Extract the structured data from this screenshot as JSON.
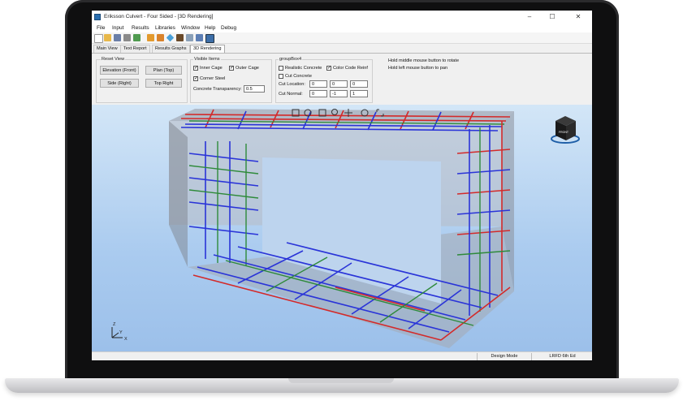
{
  "window": {
    "title": "Eriksson Culvert - Four Sided - [3D Rendering]",
    "minimize": "–",
    "maximize": "☐",
    "close": "✕"
  },
  "menu": [
    "File",
    "Input",
    "Results",
    "Libraries",
    "Window",
    "Help",
    "Debug"
  ],
  "tabs": [
    "Main View",
    "Text Report",
    "Results Graphs",
    "3D Rendering"
  ],
  "reset_view": {
    "title": "Reset View",
    "elevation": "Elevation (Front)",
    "plan": "Plan (Top)",
    "side": "Side (Right)",
    "top_right": "Top Right"
  },
  "visible_items": {
    "title": "Visible Items",
    "inner_cage": "Inner Cage",
    "outer_cage": "Outer Cage",
    "corner_steel": "Corner Steel",
    "transparency_label": "Concrete Transparency:",
    "transparency_value": "0.5"
  },
  "groupbox4": {
    "title": "groupBox4",
    "realistic": "Realistic Concrete",
    "color_code": "Color Code Reinf",
    "cut": "Cut Concrete",
    "cut_location_label": "Cut Location:",
    "cut_location": [
      "0",
      "0",
      "0"
    ],
    "cut_normal_label": "Cut Normal:",
    "cut_normal": [
      "0",
      "-1",
      "1"
    ]
  },
  "hints": {
    "line1": "Hold middle mouse button to rotate",
    "line2": "Hold left mouse button to pan"
  },
  "nav_cube_label": "FRONT",
  "axes": {
    "z": "Z",
    "y": "Y",
    "x": "X"
  },
  "status": {
    "mode": "Design Mode",
    "code": "LRFD 6th Ed"
  },
  "colors": {
    "rebar_red": "#d32a2a",
    "rebar_blue": "#2a34d8",
    "rebar_green": "#2e8a3a",
    "concrete": "#b8bcc4"
  }
}
